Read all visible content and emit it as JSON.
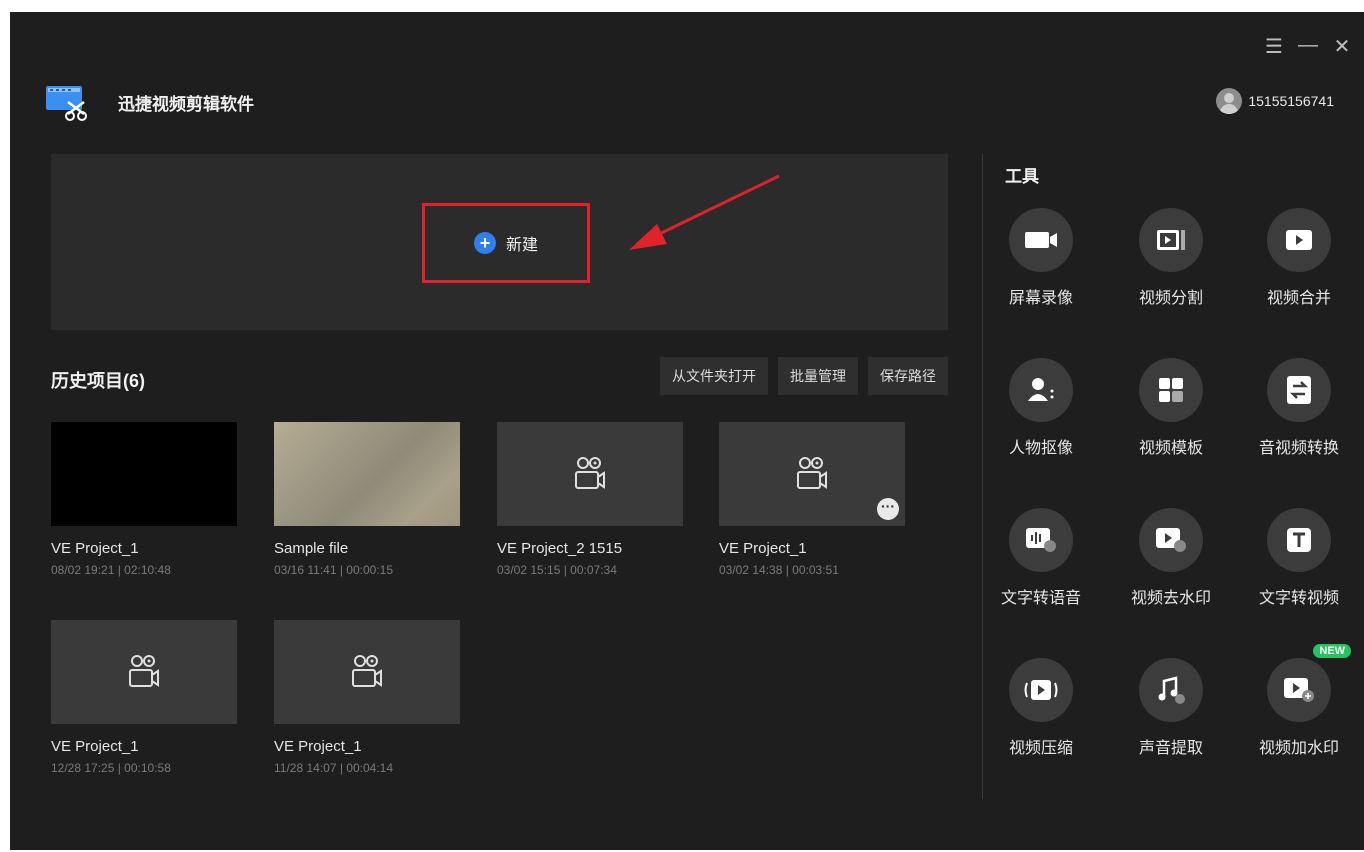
{
  "app": {
    "title": "迅捷视频剪辑软件"
  },
  "window_controls": {
    "menu": "☰",
    "minimize": "—",
    "close": "✕"
  },
  "user": {
    "account": "15155156741"
  },
  "new_panel": {
    "new_label": "新建"
  },
  "history": {
    "title": "历史项目(6)",
    "buttons": [
      "从文件夹打开",
      "批量管理",
      "保存路径"
    ],
    "projects": [
      {
        "name": "VE Project_1",
        "meta": "08/02 19:21 | 02:10:48",
        "thumb": "black"
      },
      {
        "name": "Sample file",
        "meta": "03/16 11:41 | 00:00:15",
        "thumb": "image"
      },
      {
        "name": "VE Project_2 1515",
        "meta": "03/02 15:15 | 00:07:34",
        "thumb": "camera"
      },
      {
        "name": "VE Project_1",
        "meta": "03/02 14:38 | 00:03:51",
        "thumb": "camera"
      },
      {
        "name": "VE Project_1",
        "meta": "12/28 17:25 | 00:10:58",
        "thumb": "camera"
      },
      {
        "name": "VE Project_1",
        "meta": "11/28 14:07 | 00:04:14",
        "thumb": "camera"
      }
    ]
  },
  "tools": {
    "title": "工具",
    "items": [
      {
        "label": "屏幕录像",
        "icon": "screen-record-icon"
      },
      {
        "label": "视频分割",
        "icon": "video-split-icon"
      },
      {
        "label": "视频合并",
        "icon": "video-merge-icon"
      },
      {
        "label": "人物抠像",
        "icon": "person-cutout-icon"
      },
      {
        "label": "视频模板",
        "icon": "video-template-icon"
      },
      {
        "label": "音视频转换",
        "icon": "av-convert-icon"
      },
      {
        "label": "文字转语音",
        "icon": "text-to-speech-icon"
      },
      {
        "label": "视频去水印",
        "icon": "remove-watermark-icon"
      },
      {
        "label": "文字转视频",
        "icon": "text-to-video-icon"
      },
      {
        "label": "视频压缩",
        "icon": "video-compress-icon"
      },
      {
        "label": "声音提取",
        "icon": "audio-extract-icon"
      },
      {
        "label": "视频加水印",
        "icon": "add-watermark-icon",
        "badge": "NEW"
      }
    ]
  },
  "colors": {
    "background": "#1e1e1e",
    "panel": "#2b2b2b",
    "accent": "#2f80ed",
    "highlight": "#e0222a",
    "new_badge": "#22c55e"
  }
}
